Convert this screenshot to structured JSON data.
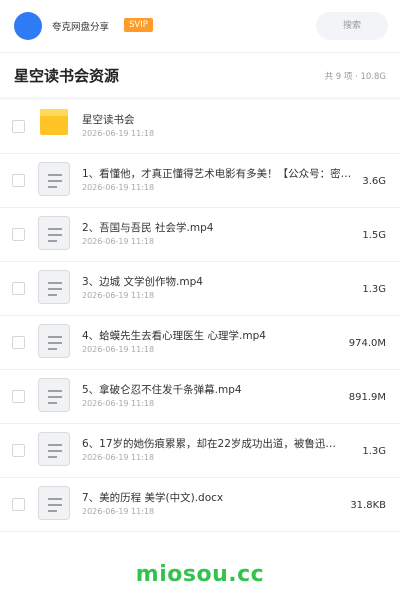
{
  "header": {
    "share_title": "夸克网盘分享",
    "badge": "SVIP",
    "search_placeholder": "搜索"
  },
  "folder": {
    "title": "星空读书会资源",
    "meta": "共 9 项 · 10.8G"
  },
  "files": [
    {
      "type": "folder",
      "name": "星空读书会",
      "date": "2026-06-19 11:18",
      "size": ""
    },
    {
      "type": "file",
      "name": "1、看懂他，才真正懂得艺术电影有多美！【公众号：密…",
      "date": "2026-06-19 11:18",
      "size": "3.6G"
    },
    {
      "type": "file",
      "name": "2、吾国与吾民  社会学.mp4",
      "date": "2026-06-19 11:18",
      "size": "1.5G"
    },
    {
      "type": "file",
      "name": "3、边城  文学创作物.mp4",
      "date": "2026-06-19 11:18",
      "size": "1.3G"
    },
    {
      "type": "file",
      "name": "4、蛤蟆先生去看心理医生  心理学.mp4",
      "date": "2026-06-19 11:18",
      "size": "974.0M"
    },
    {
      "type": "file",
      "name": "5、拿破仑忍不住发千条弹幕.mp4",
      "date": "2026-06-19 11:18",
      "size": "891.9M"
    },
    {
      "type": "file",
      "name": "6、17岁的她伤痕累累，却在22岁成功出道，被鲁迅…",
      "date": "2026-06-19 11:18",
      "size": "1.3G"
    },
    {
      "type": "file",
      "name": "7、美的历程  美学(中文).docx",
      "date": "2026-06-19 11:18",
      "size": "31.8KB"
    }
  ],
  "watermark": "miosou.cc",
  "colors": {
    "avatar": "#2f7bf5",
    "svip_badge": "#ff9b28",
    "folder_icon": "#ffc526",
    "watermark": "#33c24e"
  }
}
